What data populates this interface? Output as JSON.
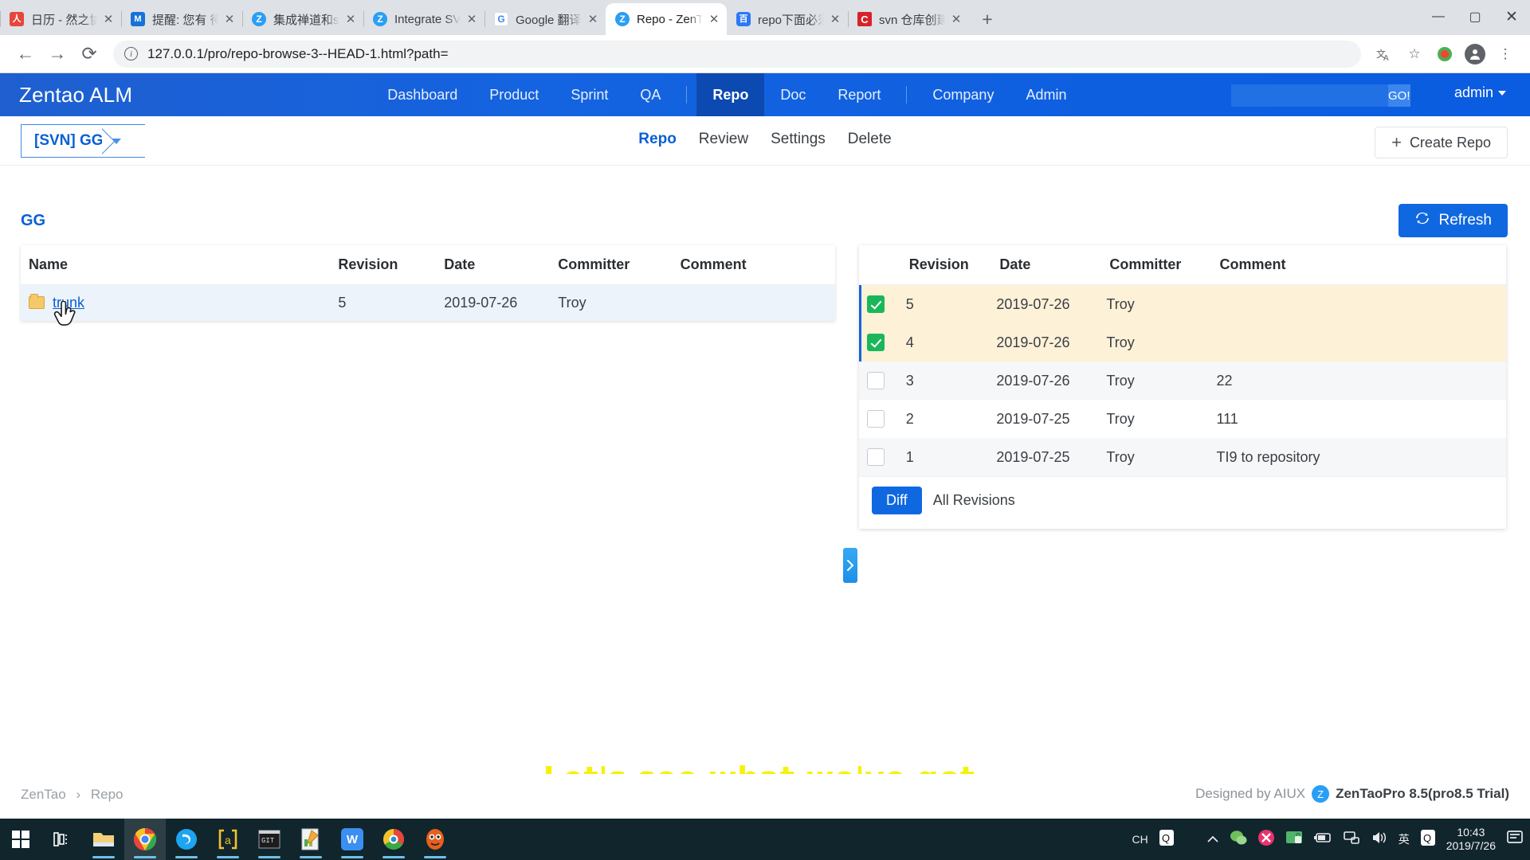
{
  "browser": {
    "tabs": [
      {
        "title": "日历 - 然之协同",
        "favicon": "calendar-icon",
        "fav_class": "fav-red",
        "fav_text": "人",
        "active": false
      },
      {
        "title": "提醒: 您有 待",
        "favicon": "mail-icon",
        "fav_class": "fav-blue",
        "fav_text": "M",
        "active": false
      },
      {
        "title": "集成禅道和svn",
        "favicon": "zentao-icon",
        "fav_class": "fav-zentao",
        "fav_text": "Z",
        "active": false
      },
      {
        "title": "Integrate SVN",
        "favicon": "zentao-icon",
        "fav_class": "fav-zentao",
        "fav_text": "Z",
        "active": false
      },
      {
        "title": "Google 翻译",
        "favicon": "google-translate-icon",
        "fav_class": "fav-google",
        "fav_text": "G",
        "active": false
      },
      {
        "title": "Repo - ZenTao",
        "favicon": "zentao-icon",
        "fav_class": "fav-zentao",
        "fav_text": "Z",
        "active": true
      },
      {
        "title": "repo下面必须",
        "favicon": "baidu-icon",
        "fav_class": "fav-baidu",
        "fav_text": "百",
        "active": false
      },
      {
        "title": "svn 仓库创建、",
        "favicon": "csdn-icon",
        "fav_class": "fav-c",
        "fav_text": "C",
        "active": false
      }
    ],
    "new_tab_label": "+",
    "close_label": "✕",
    "back_label": "←",
    "forward_label": "→",
    "reload_label": "⟳",
    "url": "127.0.0.1/pro/repo-browse-3--HEAD-1.html?path=",
    "info_icon_label": "i",
    "translate_icon_label": "⎙",
    "bookmark_icon_label": "☆",
    "extension_icon_label": "●",
    "profile_icon_label": "●",
    "menu_icon_label": "⋮",
    "window": {
      "minimize": "—",
      "maximize": "▢",
      "close": "✕"
    }
  },
  "app": {
    "logo": "Zentao ALM",
    "menu": [
      {
        "label": "Dashboard",
        "active": false
      },
      {
        "label": "Product",
        "active": false
      },
      {
        "label": "Sprint",
        "active": false
      },
      {
        "label": "QA",
        "active": false
      },
      {
        "label": "Repo",
        "active": true
      },
      {
        "label": "Doc",
        "active": false
      },
      {
        "label": "Report",
        "active": false
      },
      {
        "label": "Company",
        "active": false
      },
      {
        "label": "Admin",
        "active": false
      }
    ],
    "search": {
      "value": "",
      "placeholder": "",
      "go_label": "GO!"
    },
    "user": "admin"
  },
  "subnav": {
    "repo_selector": "[SVN] GG",
    "tabs": [
      {
        "label": "Repo",
        "active": true
      },
      {
        "label": "Review",
        "active": false
      },
      {
        "label": "Settings",
        "active": false
      },
      {
        "label": "Delete",
        "active": false
      }
    ],
    "create_repo_label": "Create Repo",
    "plus": "+"
  },
  "content": {
    "page_title": "GG",
    "refresh_label": "Refresh",
    "refresh_icon": "refresh-icon",
    "files": {
      "columns": [
        "Name",
        "Revision",
        "Date",
        "Committer",
        "Comment"
      ],
      "rows": [
        {
          "name": "trunk",
          "revision": "5",
          "date": "2019-07-26",
          "committer": "Troy",
          "comment": ""
        }
      ]
    },
    "history": {
      "columns": [
        "Revision",
        "Date",
        "Committer",
        "Comment"
      ],
      "rows": [
        {
          "checked": true,
          "revision": "5",
          "date": "2019-07-26",
          "committer": "Troy",
          "comment": ""
        },
        {
          "checked": true,
          "revision": "4",
          "date": "2019-07-26",
          "committer": "Troy",
          "comment": ""
        },
        {
          "checked": false,
          "revision": "3",
          "date": "2019-07-26",
          "committer": "Troy",
          "comment": "22"
        },
        {
          "checked": false,
          "revision": "2",
          "date": "2019-07-25",
          "committer": "Troy",
          "comment": "111"
        },
        {
          "checked": false,
          "revision": "1",
          "date": "2019-07-25",
          "committer": "Troy",
          "comment": "TI9 to repository"
        }
      ],
      "diff_label": "Diff",
      "all_revisions_label": "All Revisions"
    },
    "collapse_handle_icon": "chevron-right-icon"
  },
  "subtitle": "Let's see what we've got.",
  "footer": {
    "crumb_root": "ZenTao",
    "crumb_sep": "›",
    "crumb_current": "Repo",
    "designed_by": "Designed by AIUX",
    "product": "ZenTaoPro 8.5(pro8.5 Trial)"
  },
  "taskbar": {
    "items": [
      {
        "name": "start-button",
        "glyph": "",
        "kind": "win"
      },
      {
        "name": "task-view-button",
        "glyph": "⊟",
        "kind": "taskview"
      },
      {
        "name": "file-explorer-icon",
        "glyph": "📁",
        "kind": "explorer"
      },
      {
        "name": "chrome-icon",
        "glyph": "◉",
        "kind": "chrome"
      },
      {
        "name": "zentao-icon",
        "glyph": "Z",
        "kind": "zentao"
      },
      {
        "name": "brackets-icon",
        "glyph": "[ ]",
        "kind": "brackets"
      },
      {
        "name": "terminal-icon",
        "glyph": "▤",
        "kind": "terminal"
      },
      {
        "name": "editor-icon",
        "glyph": "✎",
        "kind": "editor"
      },
      {
        "name": "wps-writer-icon",
        "glyph": "W",
        "kind": "wps"
      },
      {
        "name": "360-browser-icon",
        "glyph": "◎",
        "kind": "threesixty"
      },
      {
        "name": "qq-browser-icon",
        "glyph": "☻",
        "kind": "qqbrowser"
      }
    ],
    "tray": {
      "ime_label": "CH",
      "qq_label": "Q",
      "chevron": "︿",
      "wechat_icon": "wechat-icon",
      "security_icon": "security-icon",
      "lock_icon": "lock-icon",
      "battery_icon": "battery-icon",
      "network_icon": "network-icon",
      "volume_icon": "volume-icon",
      "ime_en_label": "英",
      "qq2_label": "Q",
      "time": "10:43",
      "date": "2019/7/26",
      "notification_icon": "notification-icon"
    }
  }
}
